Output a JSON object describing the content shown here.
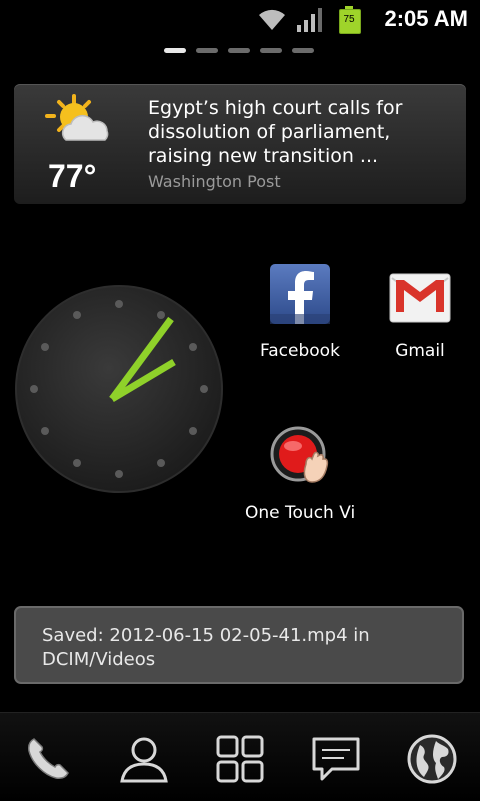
{
  "status_bar": {
    "time": "2:05 AM",
    "battery_level": "75",
    "icons": [
      "wifi-icon",
      "signal-icon",
      "battery-icon"
    ]
  },
  "home_pages": {
    "count": 5,
    "active_index": 0
  },
  "news_widget": {
    "temperature": "77°",
    "weather_icon": "partly-cloudy-icon",
    "headline": "Egypt’s high court calls for dissolution of parliament, raising new transition ...",
    "source": "Washington Post"
  },
  "apps": [
    {
      "label": "Facebook",
      "icon": "facebook-icon"
    },
    {
      "label": "Gmail",
      "icon": "gmail-icon"
    },
    {
      "label": "One Touch Vic",
      "icon": "record-button-icon"
    }
  ],
  "toast": {
    "message": "Saved: 2012-06-15 02-05-41.mp4 in DCIM/Videos"
  },
  "dock": {
    "icons": [
      "phone-icon",
      "contacts-icon",
      "app-drawer-icon",
      "messaging-icon",
      "browser-icon"
    ]
  },
  "colors": {
    "clock_hands": "#8fd12a",
    "background": "#000000",
    "toast_bg": "#4a4a4a"
  }
}
